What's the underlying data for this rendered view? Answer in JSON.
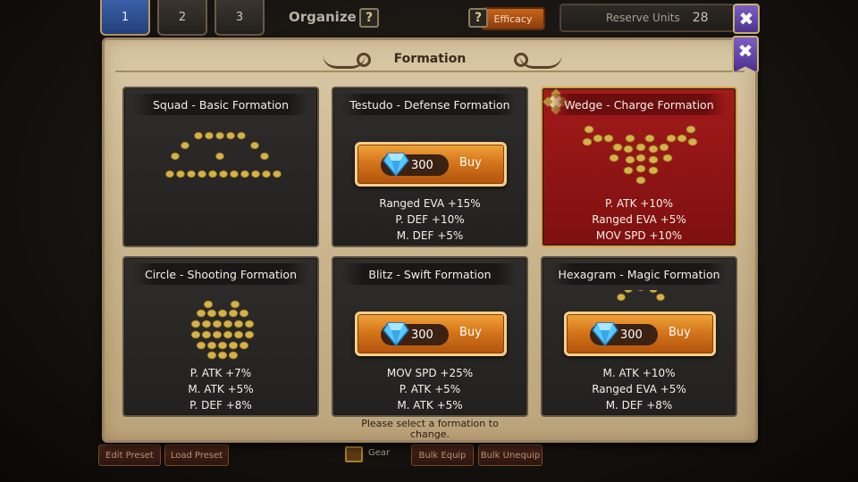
{
  "topbar": {
    "preset_tabs": [
      "1",
      "2",
      "3"
    ],
    "organize_label": "Organize",
    "help_symbol": "?",
    "efficacy_label": "Efficacy",
    "reserve_label": "Reserve Units",
    "reserve_count": "28",
    "close_symbol": "✖"
  },
  "bottom": {
    "edit_preset": "Edit Preset",
    "load_preset": "Load Preset",
    "gear_label": "Gear",
    "bulk_equip": "Bulk Equip",
    "bulk_unequip": "Bulk Unequip"
  },
  "panel": {
    "title": "Formation",
    "close_symbol": "✖",
    "footer_line1": "Please select a formation to",
    "footer_line2": "change."
  },
  "formations": [
    {
      "title": "Squad - Basic Formation",
      "locked": false,
      "selected": false,
      "stats": []
    },
    {
      "title": "Testudo - Defense Formation",
      "locked": true,
      "selected": false,
      "price": "300",
      "buy_label": "Buy",
      "stats": [
        "Ranged EVA +15%",
        "P. DEF +10%",
        "M. DEF +5%"
      ]
    },
    {
      "title": "Wedge - Charge Formation",
      "locked": false,
      "selected": true,
      "stats": [
        "P. ATK +10%",
        "Ranged EVA +5%",
        "MOV SPD +10%"
      ]
    },
    {
      "title": "Circle - Shooting Formation",
      "locked": false,
      "selected": false,
      "stats": [
        "P. ATK +7%",
        "M. ATK +5%",
        "P. DEF +8%"
      ]
    },
    {
      "title": "Blitz - Swift Formation",
      "locked": true,
      "selected": false,
      "price": "300",
      "buy_label": "Buy",
      "stats": [
        "MOV SPD +25%",
        "P. ATK +5%",
        "M. ATK +5%"
      ]
    },
    {
      "title": "Hexagram - Magic Formation",
      "locked": true,
      "selected": false,
      "price": "300",
      "buy_label": "Buy",
      "stats": [
        "M. ATK +10%",
        "Ranged EVA +5%",
        "M. DEF +8%"
      ]
    }
  ],
  "colors": {
    "selected_card": "#a31a1a",
    "card_bg": "#2a2827",
    "buy_button": "#e08a28",
    "parchment": "#d2be98",
    "unit_dot": "#d4b24a"
  },
  "icons": [
    "help-icon",
    "close-icon",
    "gem-icon",
    "selected-check-icon"
  ]
}
